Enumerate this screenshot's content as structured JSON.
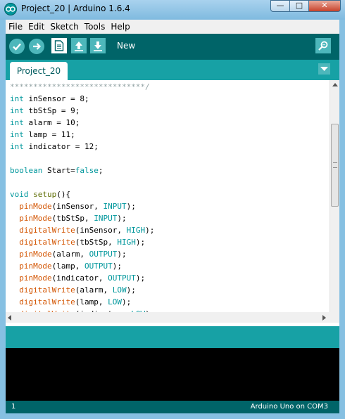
{
  "window": {
    "title": "Project_20 | Arduino 1.6.4",
    "min_glyph": "—",
    "max_glyph": "□",
    "close_glyph": "✕"
  },
  "menu": [
    "File",
    "Edit",
    "Sketch",
    "Tools",
    "Help"
  ],
  "toolbar": {
    "verify_icon": "check-icon",
    "upload_icon": "arrow-right-icon",
    "new_icon": "document-icon",
    "open_icon": "arrow-up-icon",
    "save_icon": "arrow-down-icon",
    "serial_icon": "magnifier-icon",
    "hover_label": "New"
  },
  "tabs": [
    {
      "label": "Project_20"
    }
  ],
  "editor": {
    "lines": [
      [
        [
          "*****************************/",
          "comment"
        ]
      ],
      [
        [
          "int",
          "type"
        ],
        [
          " inSensor = 8;",
          "plain"
        ]
      ],
      [
        [
          "int",
          "type"
        ],
        [
          " tbStSp = 9;",
          "plain"
        ]
      ],
      [
        [
          "int",
          "type"
        ],
        [
          " alarm = 10;",
          "plain"
        ]
      ],
      [
        [
          "int",
          "type"
        ],
        [
          " lamp = 11;",
          "plain"
        ]
      ],
      [
        [
          "int",
          "type"
        ],
        [
          " indicator = 12;",
          "plain"
        ]
      ],
      [
        [
          "",
          "plain"
        ]
      ],
      [
        [
          "boolean",
          "type"
        ],
        [
          " Start=",
          "plain"
        ],
        [
          "false",
          "const"
        ],
        [
          ";",
          "plain"
        ]
      ],
      [
        [
          "",
          "plain"
        ]
      ],
      [
        [
          "void",
          "type"
        ],
        [
          " ",
          "plain"
        ],
        [
          "setup",
          "setup"
        ],
        [
          "(){",
          "plain"
        ]
      ],
      [
        [
          "  ",
          "plain"
        ],
        [
          "pinMode",
          "func"
        ],
        [
          "(inSensor, ",
          "plain"
        ],
        [
          "INPUT",
          "const"
        ],
        [
          ");",
          "plain"
        ]
      ],
      [
        [
          "  ",
          "plain"
        ],
        [
          "pinMode",
          "func"
        ],
        [
          "(tbStSp, ",
          "plain"
        ],
        [
          "INPUT",
          "const"
        ],
        [
          ");",
          "plain"
        ]
      ],
      [
        [
          "  ",
          "plain"
        ],
        [
          "digitalWrite",
          "func"
        ],
        [
          "(inSensor, ",
          "plain"
        ],
        [
          "HIGH",
          "const"
        ],
        [
          ");",
          "plain"
        ]
      ],
      [
        [
          "  ",
          "plain"
        ],
        [
          "digitalWrite",
          "func"
        ],
        [
          "(tbStSp, ",
          "plain"
        ],
        [
          "HIGH",
          "const"
        ],
        [
          ");",
          "plain"
        ]
      ],
      [
        [
          "  ",
          "plain"
        ],
        [
          "pinMode",
          "func"
        ],
        [
          "(alarm, ",
          "plain"
        ],
        [
          "OUTPUT",
          "const"
        ],
        [
          ");",
          "plain"
        ]
      ],
      [
        [
          "  ",
          "plain"
        ],
        [
          "pinMode",
          "func"
        ],
        [
          "(lamp, ",
          "plain"
        ],
        [
          "OUTPUT",
          "const"
        ],
        [
          ");",
          "plain"
        ]
      ],
      [
        [
          "  ",
          "plain"
        ],
        [
          "pinMode",
          "func"
        ],
        [
          "(indicator, ",
          "plain"
        ],
        [
          "OUTPUT",
          "const"
        ],
        [
          ");",
          "plain"
        ]
      ],
      [
        [
          "  ",
          "plain"
        ],
        [
          "digitalWrite",
          "func"
        ],
        [
          "(alarm, ",
          "plain"
        ],
        [
          "LOW",
          "const"
        ],
        [
          ");",
          "plain"
        ]
      ],
      [
        [
          "  ",
          "plain"
        ],
        [
          "digitalWrite",
          "func"
        ],
        [
          "(lamp, ",
          "plain"
        ],
        [
          "LOW",
          "const"
        ],
        [
          ");",
          "plain"
        ]
      ],
      [
        [
          "  ",
          "plain"
        ],
        [
          "digitalWrite",
          "func"
        ],
        [
          "(indicator, ",
          "plain"
        ],
        [
          "LOW",
          "const"
        ],
        [
          ");",
          "plain"
        ]
      ]
    ]
  },
  "status": {
    "line_number": "1",
    "board": "Arduino Uno on COM3"
  },
  "colors": {
    "toolbar": "#006468",
    "tab_bar": "#17a1a5",
    "button": "#4db7bb",
    "keyword_type": "#00979c",
    "function": "#d35400",
    "comment": "#95a5a6",
    "console": "#000000"
  }
}
